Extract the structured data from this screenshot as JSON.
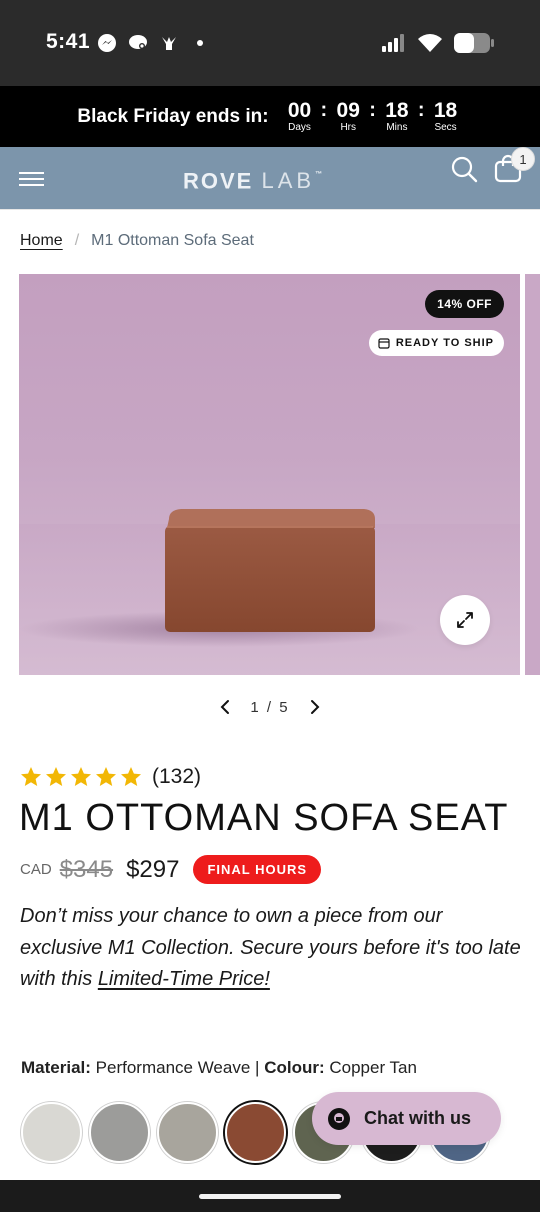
{
  "status_bar": {
    "time": "5:41",
    "left_icons": [
      "messenger-icon",
      "chat-bubble-icon",
      "bird-icon",
      "dot-icon"
    ],
    "right_icons": [
      "signal-icon",
      "wifi-icon",
      "battery-icon"
    ]
  },
  "countdown": {
    "label": "Black Friday ends in:",
    "units": [
      {
        "value": "00",
        "caption": "Days"
      },
      {
        "value": "09",
        "caption": "Hrs"
      },
      {
        "value": "18",
        "caption": "Mins"
      },
      {
        "value": "18",
        "caption": "Secs"
      }
    ]
  },
  "header": {
    "logo_main": "ROVE",
    "logo_light": "LAB",
    "logo_tm": "™",
    "cart_count": "1",
    "bg_color": "#7c95ab"
  },
  "breadcrumb": {
    "home": "Home",
    "separator": "/",
    "current": "M1 Ottoman Sofa Seat"
  },
  "gallery": {
    "discount_badge": "14% OFF",
    "ship_badge": "READY TO SHIP",
    "pager": {
      "current": "1",
      "separator": "/",
      "total": "5"
    }
  },
  "product": {
    "rating_stars": 5,
    "review_count": "(132)",
    "title": "M1 OTTOMAN SOFA SEAT",
    "currency": "CAD",
    "price_old": "$345",
    "price_new": "$297",
    "urgency_badge": "FINAL HOURS",
    "promo_text": "Don’t miss your chance to own a piece from our exclusive M1 Collection. Secure yours before it's too late with this ",
    "promo_link": "Limited-Time Price!"
  },
  "options": {
    "material_label": "Material:",
    "material_value": "Performance Weave",
    "divider": "|",
    "colour_label": "Colour:",
    "colour_value": "Copper Tan",
    "swatches": [
      {
        "name": "light-grey",
        "color": "#d9d8d3"
      },
      {
        "name": "grey",
        "color": "#9c9c9a"
      },
      {
        "name": "stone",
        "color": "#a8a59d"
      },
      {
        "name": "copper-tan",
        "color": "#8a4a33",
        "selected": true
      },
      {
        "name": "olive",
        "color": "#5f6450"
      },
      {
        "name": "black",
        "color": "#1d1d1d"
      },
      {
        "name": "slate-blue",
        "color": "#4f6585"
      }
    ]
  },
  "chat": {
    "label": "Chat with us"
  }
}
